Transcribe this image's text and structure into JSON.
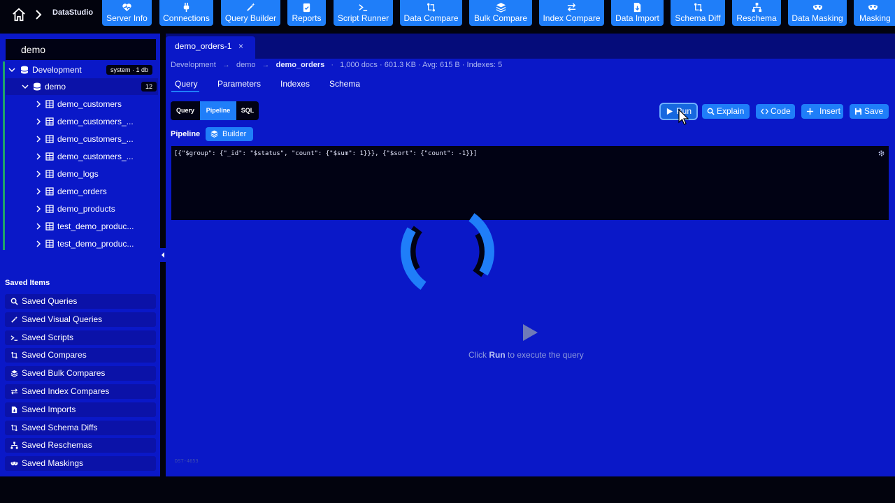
{
  "topbar": {
    "brand": "DataStudio",
    "nav": [
      {
        "label": "Server Info",
        "icon": "heart-monitor-icon"
      },
      {
        "label": "Connections",
        "icon": "plug-icon"
      },
      {
        "label": "Query Builder",
        "icon": "magic-wand-icon"
      },
      {
        "label": "Reports",
        "icon": "clipboard-check-icon"
      },
      {
        "label": "Script Runner",
        "icon": "terminal-icon"
      },
      {
        "label": "Data Compare",
        "icon": "compare-icon"
      },
      {
        "label": "Bulk Compare",
        "icon": "layers-icon"
      },
      {
        "label": "Index Compare",
        "icon": "swap-arrows-icon"
      },
      {
        "label": "Data Import",
        "icon": "file-import-icon"
      },
      {
        "label": "Schema Diff",
        "icon": "diff-icon"
      },
      {
        "label": "Reschema",
        "icon": "hierarchy-icon"
      },
      {
        "label": "Data Masking",
        "icon": "mask-icon"
      },
      {
        "label": "Masking",
        "icon": "mask-icon"
      }
    ]
  },
  "sidebar": {
    "db_title": "demo",
    "connection": {
      "label": "Development",
      "badge": "system · 1 db"
    },
    "database": {
      "label": "demo",
      "badge": "12"
    },
    "collections": [
      "demo_customers",
      "demo_customers_...",
      "demo_customers_...",
      "demo_customers_...",
      "demo_logs",
      "demo_orders",
      "demo_products",
      "test_demo_produc...",
      "test_demo_produc..."
    ],
    "saved_header": "Saved Items",
    "saved_items": [
      {
        "label": "Saved Queries",
        "icon": "search-icon"
      },
      {
        "label": "Saved Visual Queries",
        "icon": "magic-wand-icon"
      },
      {
        "label": "Saved Scripts",
        "icon": "terminal-icon"
      },
      {
        "label": "Saved Compares",
        "icon": "compare-icon"
      },
      {
        "label": "Saved Bulk Compares",
        "icon": "layers-icon"
      },
      {
        "label": "Saved Index Compares",
        "icon": "swap-arrows-icon"
      },
      {
        "label": "Saved Imports",
        "icon": "file-import-icon"
      },
      {
        "label": "Saved Schema Diffs",
        "icon": "diff-icon"
      },
      {
        "label": "Saved Reschemas",
        "icon": "hierarchy-icon"
      },
      {
        "label": "Saved Maskings",
        "icon": "mask-icon"
      }
    ]
  },
  "main": {
    "tab": {
      "label": "demo_orders-1",
      "close": "×"
    },
    "breadcrumb": {
      "connection": "Development",
      "database": "demo",
      "collection": "demo_orders",
      "stats": "1,000 docs · 601.3 KB · Avg: 615 B · Indexes: 5",
      "separator": "→"
    },
    "subtabs": [
      "Query",
      "Parameters",
      "Indexes",
      "Schema"
    ],
    "modes": [
      "Query",
      "Pipeline",
      "SQL"
    ],
    "pipeline_label": "Pipeline",
    "builder_label": "Builder",
    "actions": {
      "run": "Run",
      "explain": "Explain",
      "code": "Code",
      "insert": "Insert",
      "save": "Save"
    },
    "pipeline_code": "[{\"$group\": {\"_id\": \"$status\", \"count\": {\"$sum\": 1}}}, {\"$sort\": {\"count\": -1}}]",
    "empty": {
      "prefix": "Click ",
      "action": "Run",
      "suffix": " to execute the query"
    },
    "version_tag": "DST-4653"
  },
  "colors": {
    "accent": "#1f7ef9",
    "panel": "#0a18c8",
    "editor_bg": "#010214",
    "tree_indicator": "#1fa36b"
  }
}
